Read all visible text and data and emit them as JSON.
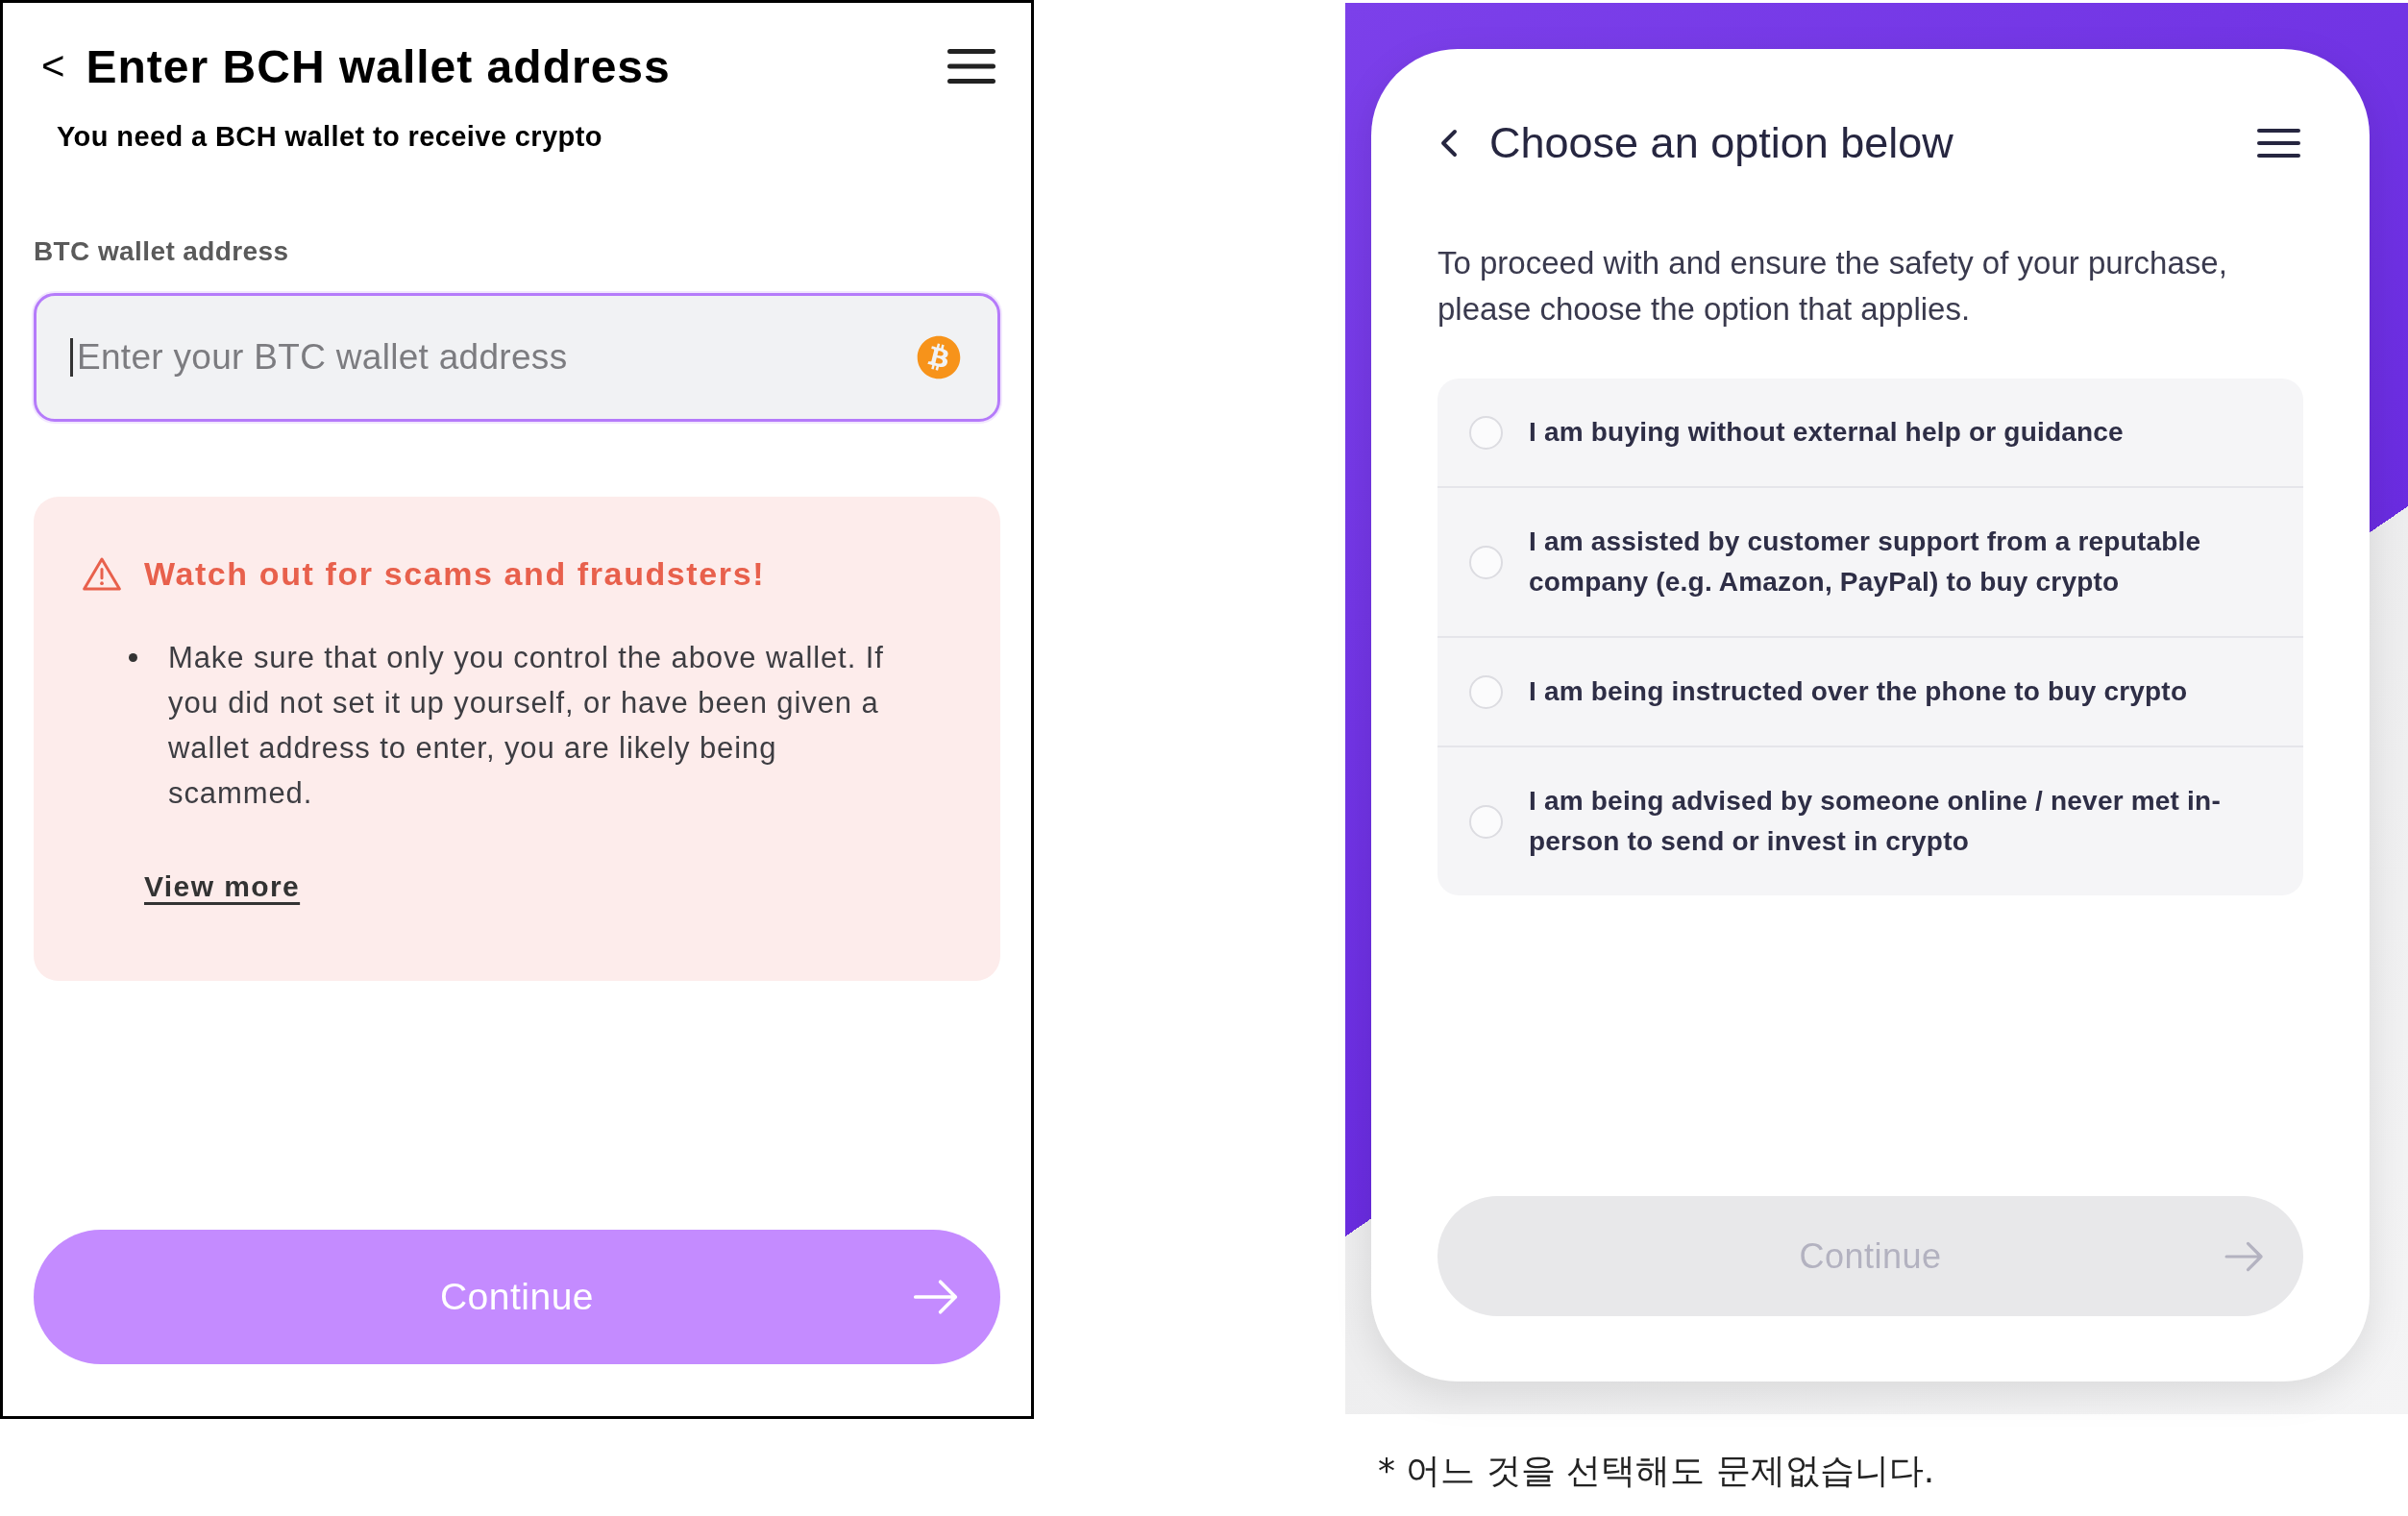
{
  "wallet_screen": {
    "header": {
      "back": "<",
      "title": "Enter BCH wallet address"
    },
    "subtitle": "You need a BCH wallet to receive crypto",
    "address_field": {
      "label": "BTC wallet address",
      "placeholder": "Enter your BTC wallet address",
      "focused": true
    },
    "warning": {
      "title": "Watch out for scams and fraudsters!",
      "bullets": [
        "Make sure that only you control the above wallet. If you did not set it up yourself, or have been given a wallet address to enter, you are likely being scammed."
      ],
      "link": "View more"
    },
    "continue_button": {
      "label": "Continue",
      "disabled": false
    }
  },
  "options_screen": {
    "header": {
      "title": "Choose an option below"
    },
    "description": "To proceed with and ensure the safety of your purchase, please choose the option that applies.",
    "options": [
      {
        "label": "I am buying without external help or guidance",
        "selected": false
      },
      {
        "label": "I am assisted by customer support from a reputable company (e.g. Amazon, PayPal) to buy crypto",
        "selected": false
      },
      {
        "label": "I am being instructed over the phone to buy crypto",
        "selected": false
      },
      {
        "label": "I am being advised by someone online / never met in-person to send or invest in crypto",
        "selected": false
      }
    ],
    "continue_button": {
      "label": "Continue",
      "disabled": true
    }
  },
  "note": "* 어느 것을 선택해도 문제없습니다."
}
